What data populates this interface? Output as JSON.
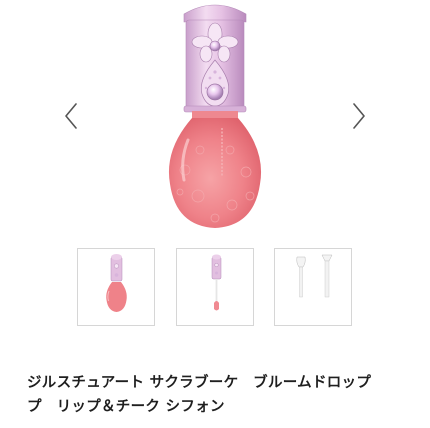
{
  "gallery": {
    "prev_icon": "chevron-left-icon",
    "next_icon": "chevron-right-icon",
    "main_image": "pink-lip-cheek-bottle-image",
    "thumbnails": [
      {
        "image": "bottle-front-thumbnail",
        "selected": true
      },
      {
        "image": "bottle-applicator-thumbnail",
        "selected": false
      },
      {
        "image": "applicator-tip-thumbnail",
        "selected": false,
        "caption": ""
      }
    ]
  },
  "product": {
    "title": "ジルスチュアート サクラブーケ　ブルームドロップ\nプ　リップ＆チーク シフォン"
  },
  "colors": {
    "bottle_pink": "#f07e86",
    "cap_lavender": "#e2bfe0",
    "arrow": "#555555",
    "thumb_border": "#d6d6d6"
  }
}
